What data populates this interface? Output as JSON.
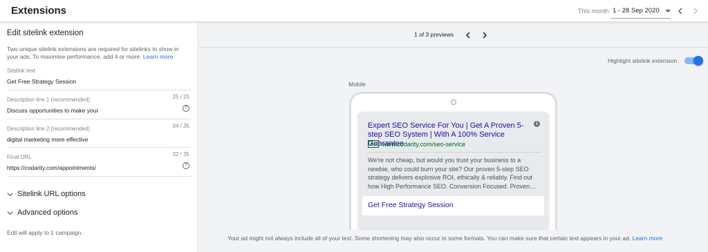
{
  "header": {
    "title": "Extensions",
    "date_label": "This month",
    "date_range": "1 - 28 Sep 2020"
  },
  "editor": {
    "title": "Edit sitelink extension",
    "description": "Two unique sitelink extensions are required for sitelinks to show in your ads. To maximise performance, add 4 or more.",
    "learn_more": "Learn more",
    "fields": {
      "sitelink_text": {
        "label": "Sitelink text",
        "value": "Get Free Strategy Session"
      },
      "desc1": {
        "label": "Description line 1 (recommended)",
        "value": "Discuss opportunities to make your",
        "count": "25 / 25"
      },
      "desc2": {
        "label": "Description line 2 (recommended)",
        "value": "digital marketing more effective",
        "count": "34 / 35"
      },
      "final_url": {
        "label": "Final URL",
        "value": "https://codarity.com/appointments/",
        "count": "32 / 35"
      }
    },
    "sitelink_url_options": "Sitelink URL options",
    "advanced_options": "Advanced options",
    "apply_note": "Edit will apply to 1 campaign."
  },
  "preview": {
    "count": "1 of 3 previews",
    "highlight_label": "Highlight sitelink extension",
    "highlight_on": true,
    "device_label": "Mobile",
    "ad": {
      "headline": "Expert SEO Service For You | Get A Proven 5-step SEO System | With A 100% Service Guarantee",
      "badge": "Ad",
      "display_url": "www.codarity.com/seo-service",
      "description": "We're not cheap, but would you trust your business to a newbie, who could burn your site? Our proven 5-step SEO strategy delivers explosive ROI, ethically & reliably. Find out how High Performance SEO. Conversion Focused. Proven…",
      "sitelink": "Get Free Strategy Session"
    },
    "footer_note": "Your ad might not always include all of your text. Some shortening may also occur in some formats. You can make sure that certain text appears in your ad.",
    "footer_link": "Learn more"
  },
  "colors": {
    "accent": "#1a73e8",
    "ad_headline": "#1a0dab",
    "ad_url": "#006621"
  }
}
